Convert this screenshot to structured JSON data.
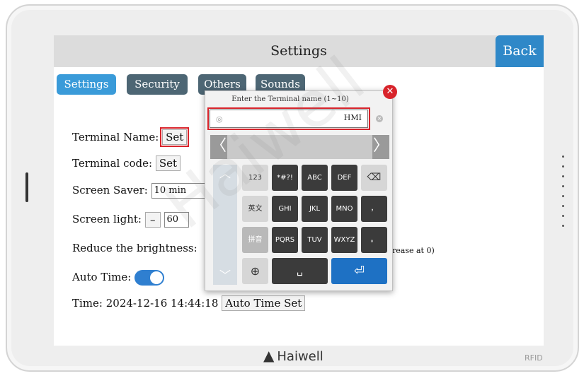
{
  "screen": {
    "title": "Settings",
    "back_label": "Back"
  },
  "tabs": [
    {
      "label": "Settings",
      "active": true
    },
    {
      "label": "Security",
      "active": false
    },
    {
      "label": "Others",
      "active": false
    },
    {
      "label": "Sounds",
      "active": false
    }
  ],
  "settings": {
    "terminal_name_label": "Terminal Name:",
    "terminal_name_button": "Set",
    "terminal_code_label": "Terminal code:",
    "terminal_code_button": "Set",
    "screen_saver_label": "Screen Saver:",
    "screen_saver_value": "10 min",
    "screen_light_label": "Screen light:",
    "screen_light_minus": "–",
    "screen_light_value": "60",
    "reduce_brightness_label": "Reduce the brightness:",
    "reduce_brightness_note": "rease at 0)",
    "auto_time_label": "Auto Time:",
    "auto_time_on": true,
    "time_label": "Time:",
    "time_value": "2024-12-16 14:44:18",
    "auto_time_set_button": "Auto Time Set"
  },
  "keyboard": {
    "prompt": "Enter the Terminal name (1~10)",
    "input_value": "HMI",
    "close_icon": "✕",
    "eye_icon": "◎",
    "clear_icon": "×",
    "prev_icon": "〈",
    "next_icon": "〉",
    "up_icon": "︿",
    "down_icon": "﹀",
    "keys_row1": [
      "123",
      "*#?!",
      "ABC",
      "DEF",
      "⌫"
    ],
    "keys_row2": [
      "英文",
      "GHI",
      "JKL",
      "MNO",
      "，"
    ],
    "keys_row3": [
      "拼音",
      "PQRS",
      "TUV",
      "WXYZ",
      "。"
    ],
    "globe_icon": "⊕",
    "space_icon": "␣",
    "enter_icon": "⏎"
  },
  "brand": {
    "name": "Haiwell",
    "logo_icon": "▲",
    "rfid_label": "RFID"
  },
  "watermark": "Haiwell"
}
